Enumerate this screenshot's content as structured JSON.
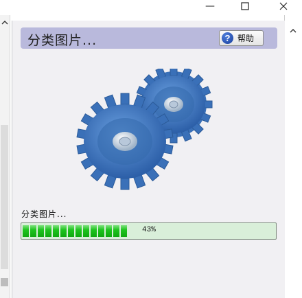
{
  "window": {
    "minimize_glyph": "—",
    "maximize_glyph": "☐",
    "close_glyph": "✕"
  },
  "dialog": {
    "title": "分类图片...",
    "help_button": {
      "icon": "help-icon",
      "icon_glyph": "?",
      "label": "帮助"
    }
  },
  "illustration": {
    "icon": "gears-icon",
    "color": "#3d78c4"
  },
  "status": {
    "label": "分类图片...",
    "progress_value": 0.43,
    "progress_text": "43%"
  },
  "colors": {
    "header_bg": "#b9b9dc",
    "panel_bg": "#f1f0f3",
    "progress_track": "#d9efd9",
    "progress_fill": "#1ec41e"
  }
}
